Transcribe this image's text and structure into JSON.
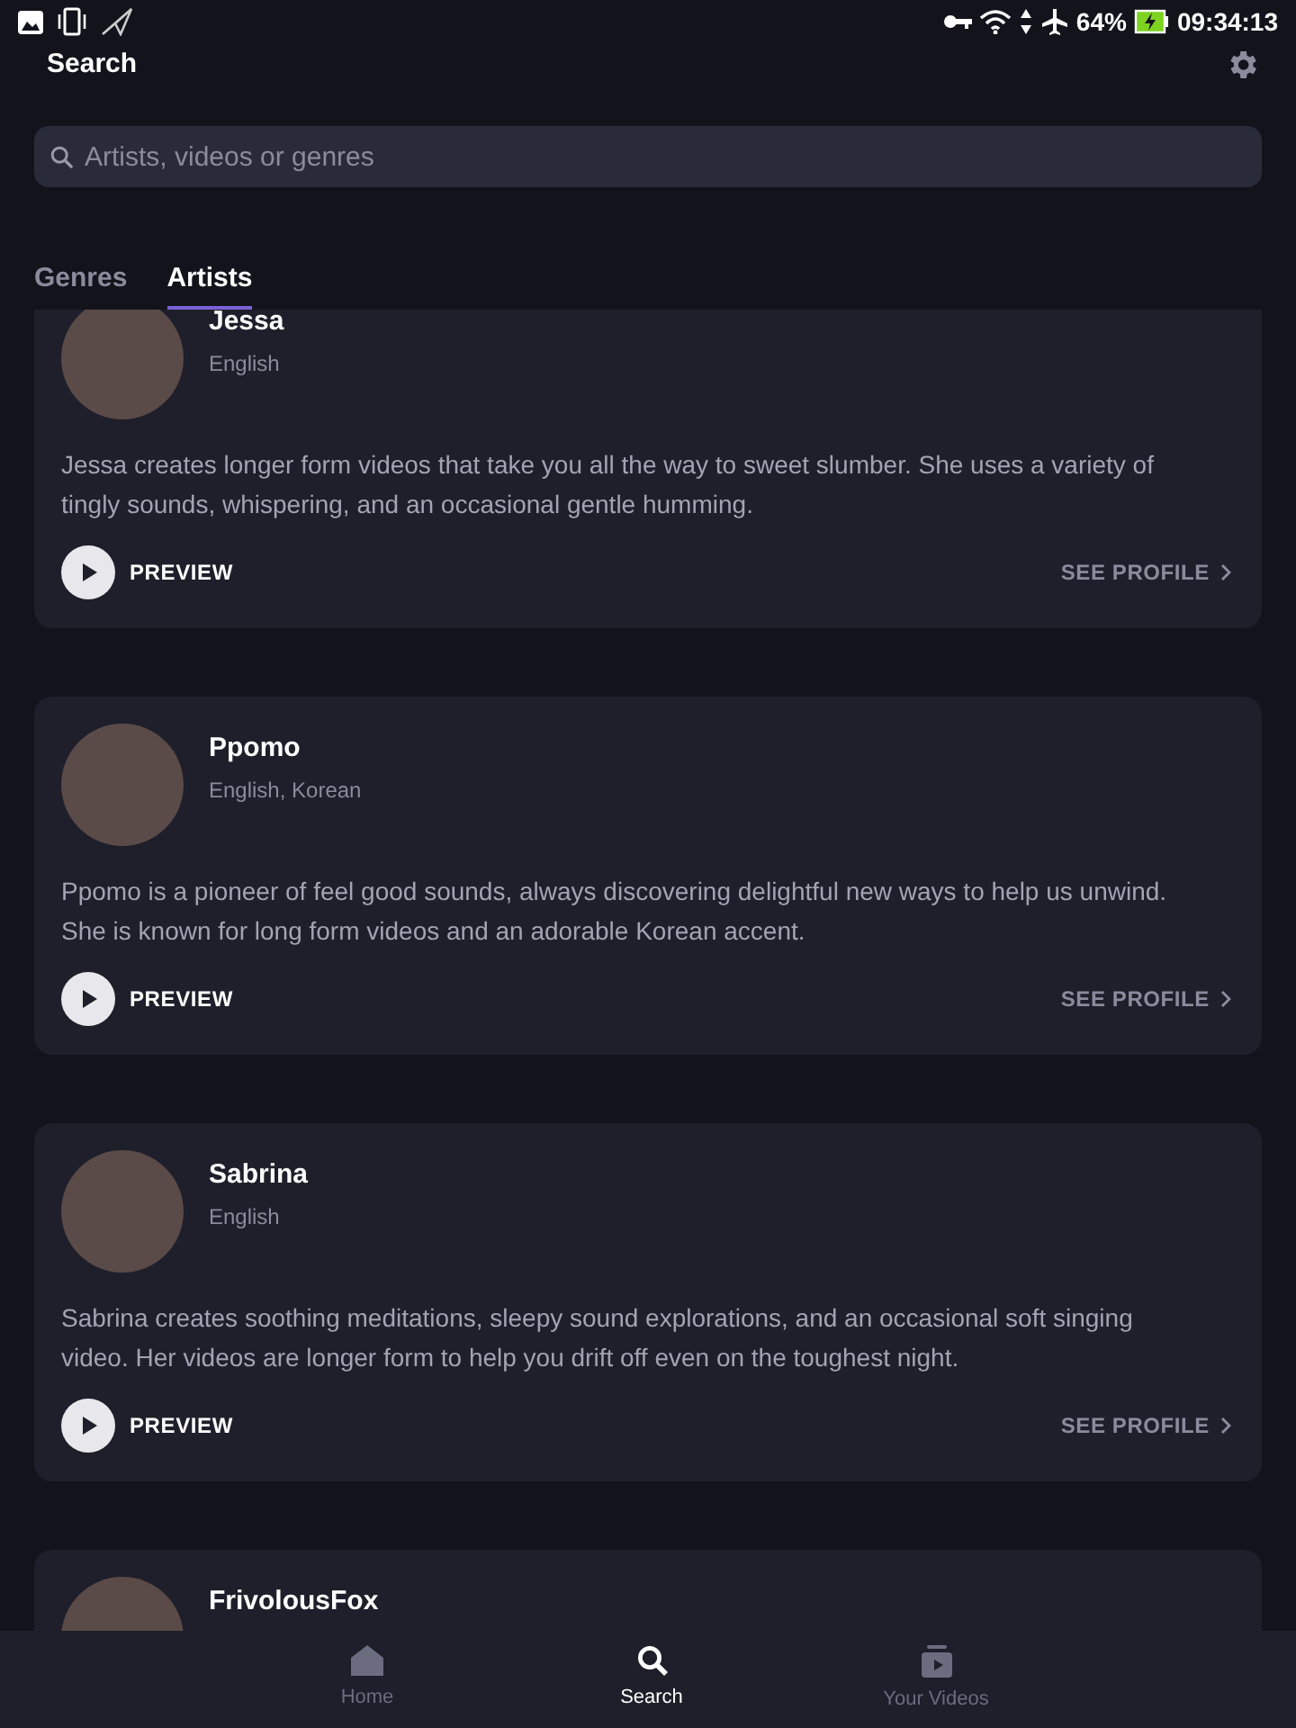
{
  "status_bar": {
    "battery": "64%",
    "time": "09:34:13"
  },
  "header": {
    "title": "Search"
  },
  "search": {
    "placeholder": "Artists, videos or genres"
  },
  "tabs": [
    {
      "label": "Genres",
      "selected": false
    },
    {
      "label": "Artists",
      "selected": true
    }
  ],
  "artists": [
    {
      "name": "Jessa",
      "languages": "English",
      "description": "Jessa creates longer form videos that take you all the way to sweet slumber. She uses a variety of tingly sounds, whispering, and an occasional gentle humming.",
      "preview": "PREVIEW",
      "profile": "SEE PROFILE"
    },
    {
      "name": "Ppomo",
      "languages": "English, Korean",
      "description": "Ppomo is a pioneer of feel good sounds, always discovering delightful new ways to help us unwind. She is known for long form videos and an adorable Korean accent.",
      "preview": "PREVIEW",
      "profile": "SEE PROFILE"
    },
    {
      "name": "Sabrina",
      "languages": "English",
      "description": "Sabrina creates soothing meditations, sleepy sound explorations, and an occasional soft singing video. Her videos are longer form to help you drift off even on the toughest night.",
      "preview": "PREVIEW",
      "profile": "SEE PROFILE"
    },
    {
      "name": "FrivolousFox"
    }
  ],
  "bottom_nav": [
    {
      "label": "Home",
      "selected": false
    },
    {
      "label": "Search",
      "selected": true
    },
    {
      "label": "Your Videos",
      "selected": false
    }
  ]
}
